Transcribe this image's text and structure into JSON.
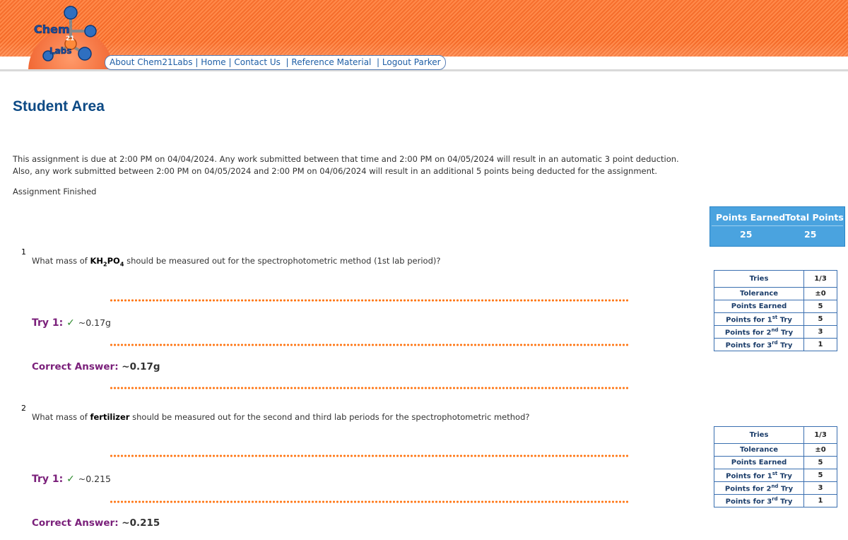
{
  "header": {
    "logo_text_top": "Chem",
    "logo_text_mid": "21",
    "logo_text_bottom": "Labs",
    "nav": [
      "About Chem21Labs",
      "Home",
      "Contact Us",
      "Reference Material",
      "Logout Parker"
    ]
  },
  "page_title": "Student Area",
  "notice": {
    "line1": "This assignment is due at 2:00 PM on 04/04/2024. Any work submitted between that time and 2:00 PM on 04/05/2024 will result in an automatic 3 point deduction.",
    "line2": "Also, any work submitted between 2:00 PM on 04/05/2024 and 2:00 PM on 04/06/2024 will result in an additional 5 points being deducted for the assignment.",
    "status": "Assignment Finished"
  },
  "points": {
    "earned_label": "Points Earned",
    "total_label": "Total Points",
    "earned": "25",
    "total": "25"
  },
  "questions": [
    {
      "number": "1",
      "text_before": "What mass of ",
      "formula_parts": [
        "KH",
        "2",
        "PO",
        "4"
      ],
      "text_after": " should be measured out for the spectrophotometric method (1st lab period)?",
      "try_label": "Try 1:",
      "check": "✓",
      "try_answer": "~0.17g",
      "correct_label": "Correct Answer:",
      "correct_value": "~0.17g",
      "stats": {
        "tries": "1/3",
        "tolerance": "±0",
        "points_earned": "5",
        "try1": "5",
        "try2": "3",
        "try3": "1"
      }
    },
    {
      "number": "2",
      "text_before": "What mass of ",
      "bold_word": "fertilizer",
      "text_after": " should be measured out for the second and third lab periods for the spectrophotometric method?",
      "try_label": "Try 1:",
      "check": "✓",
      "try_answer": "~0.215",
      "correct_label": "Correct Answer:",
      "correct_value": "~0.215",
      "stats": {
        "tries": "1/3",
        "tolerance": "±0",
        "points_earned": "5",
        "try1": "5",
        "try2": "3",
        "try3": "1"
      }
    }
  ],
  "stats_labels": {
    "tries": "Tries",
    "tolerance": "Tolerance",
    "points_earned": "Points Earned",
    "points_for": "Points for",
    "try": "Try",
    "ord1": "1",
    "ord1_sup": "st",
    "ord2": "2",
    "ord2_sup": "nd",
    "ord3": "3",
    "ord3_sup": "rd"
  },
  "colors": {
    "header_orange": "#f46a28",
    "title_blue": "#0d4a85",
    "nav_blue": "#1f5fa6",
    "purple": "#7a1f7a",
    "check_green": "#2e8b2e",
    "points_box": "#4aa3df"
  }
}
